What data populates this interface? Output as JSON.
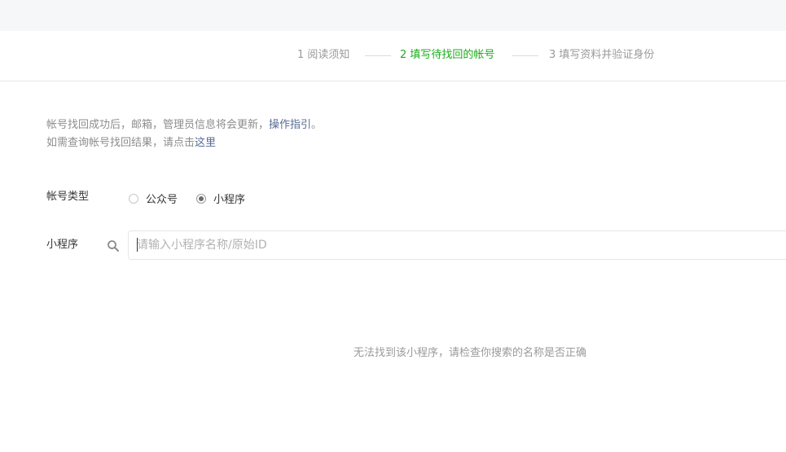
{
  "steps": [
    {
      "label": "1 阅读须知",
      "state": "done"
    },
    {
      "label": "2 填写待找回的帐号",
      "state": "active"
    },
    {
      "label": "3 填写资料并验证身份",
      "state": "pending"
    }
  ],
  "notice": {
    "line1_text": "帐号找回成功后，邮箱，管理员信息将会更新，",
    "line1_link": "操作指引",
    "line1_end": "。",
    "line2_text": "如需查询帐号找回结果，请点击",
    "line2_link": "这里"
  },
  "form": {
    "account_type_label": "帐号类型",
    "options": [
      {
        "label": "公众号",
        "checked": false
      },
      {
        "label": "小程序",
        "checked": true
      }
    ],
    "search_label": "小程序",
    "search_placeholder": "请输入小程序名称/原始ID",
    "search_value": ""
  },
  "empty_message": "无法找到该小程序，请检查你搜索的名称是否正确",
  "colors": {
    "active_step": "#1aad19",
    "link": "#576b95",
    "muted": "#9a9a9a"
  }
}
